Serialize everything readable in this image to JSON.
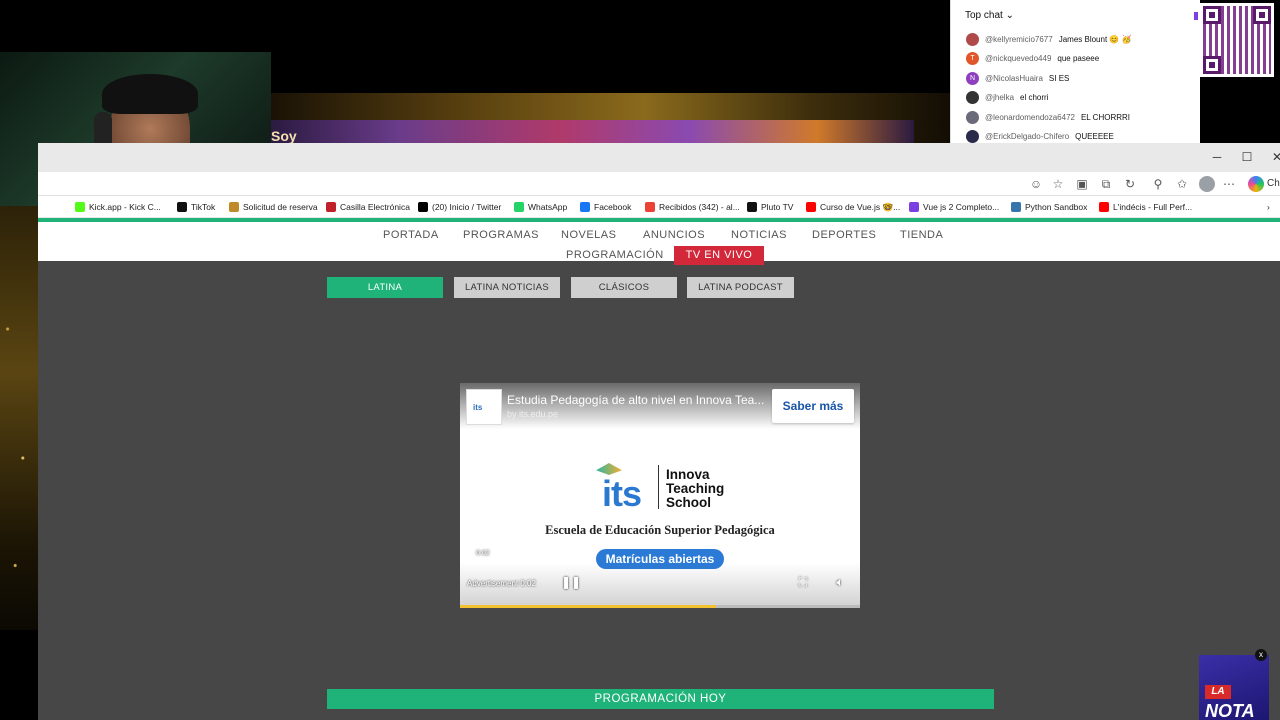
{
  "stream": {
    "banner_text": "Soy"
  },
  "chat": {
    "header": "Top chat",
    "messages": [
      {
        "user": "@kellyremicio7677",
        "text": "James Blount 😊 🥳",
        "avatar": "",
        "color": "#b04a4a"
      },
      {
        "user": "@nickquevedo449",
        "text": "que paseee",
        "avatar": "T",
        "color": "#e0552a"
      },
      {
        "user": "@NicolasHuaira",
        "text": "SI ES",
        "avatar": "N",
        "color": "#8e3fc0"
      },
      {
        "user": "@jhelka",
        "text": "el chorri",
        "avatar": "",
        "color": "#333333"
      },
      {
        "user": "@leonardomendoza6472",
        "text": "EL CHORRRI",
        "avatar": "",
        "color": "#6a6a7a"
      },
      {
        "user": "@ErickDelgado-Chifero",
        "text": "QUEEEEE",
        "avatar": "",
        "color": "#2a2a4a"
      }
    ]
  },
  "browser": {
    "window_controls": {
      "minimize": "─",
      "maximize": "☐",
      "close": "✕"
    },
    "copilot_label": "Cha",
    "bookmarks": [
      {
        "label": "Kick.app - Kick C...",
        "color": "#53fc18"
      },
      {
        "label": "TikTok",
        "color": "#111111"
      },
      {
        "label": "Solicitud de reserva",
        "color": "#c08a2a"
      },
      {
        "label": "Casilla Electrónica",
        "color": "#c0202a"
      },
      {
        "label": "(20) Inicio / Twitter",
        "color": "#000000"
      },
      {
        "label": "WhatsApp",
        "color": "#25d366"
      },
      {
        "label": "Facebook",
        "color": "#1877f2"
      },
      {
        "label": "Recibidos (342) - al...",
        "color": "#ea4335"
      },
      {
        "label": "Pluto TV",
        "color": "#111111"
      },
      {
        "label": "Curso de Vue.js 🤓...",
        "color": "#ff0000"
      },
      {
        "label": "Vue js 2 Completo...",
        "color": "#7b3fe4"
      },
      {
        "label": "Python Sandbox",
        "color": "#3776ab"
      },
      {
        "label": "L'indécis - Full Perf...",
        "color": "#ff0000"
      }
    ]
  },
  "site": {
    "nav": [
      "PORTADA",
      "PROGRAMAS",
      "NOVELAS",
      "ANUNCIOS",
      "NOTICIAS",
      "DEPORTES",
      "TIENDA"
    ],
    "subnav": [
      "PROGRAMACIÓN",
      "TV EN VIVO"
    ],
    "channels": [
      "LATINA",
      "LATINA NOTICIAS",
      "CLÁSICOS",
      "LATINA PODCAST"
    ],
    "programacion_hoy": "PROGRAMACIÓN HOY",
    "accent_green": "#1fb37a",
    "accent_red": "#d2283a"
  },
  "ad": {
    "title": "Estudia Pedagogía de alto nivel en Innova Tea...",
    "by": "by its.edu.pe",
    "cta": "Saber más",
    "logo_word": "its",
    "logo_name_line1": "Innova",
    "logo_name_line2": "Teaching",
    "logo_name_line3": "School",
    "subtitle": "Escuela de Educación Superior Pedagógica",
    "pill": "Matrículas abiertas",
    "small_time": "0:02",
    "time_label": "Advertisement 0:02",
    "progress_fraction": 0.64
  },
  "badge": {
    "la": "LA",
    "word": "NOTA",
    "close": "x"
  }
}
